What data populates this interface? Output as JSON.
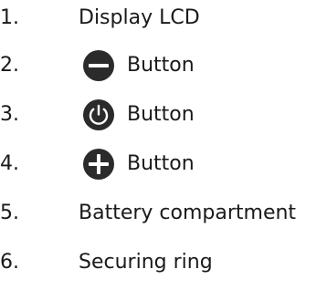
{
  "items": [
    {
      "number": "1.",
      "label": "Display LCD"
    },
    {
      "number": "2.",
      "label": "Button",
      "icon": "minus-circle-icon"
    },
    {
      "number": "3.",
      "label": "Button",
      "icon": "power-circle-icon"
    },
    {
      "number": "4.",
      "label": "Button",
      "icon": "plus-circle-icon"
    },
    {
      "number": "5.",
      "label": "Battery compartment"
    },
    {
      "number": "6.",
      "label": "Securing ring"
    }
  ],
  "colors": {
    "text": "#1a1a1a",
    "icon_fill": "#2b2b2b",
    "icon_glyph": "#ffffff"
  }
}
